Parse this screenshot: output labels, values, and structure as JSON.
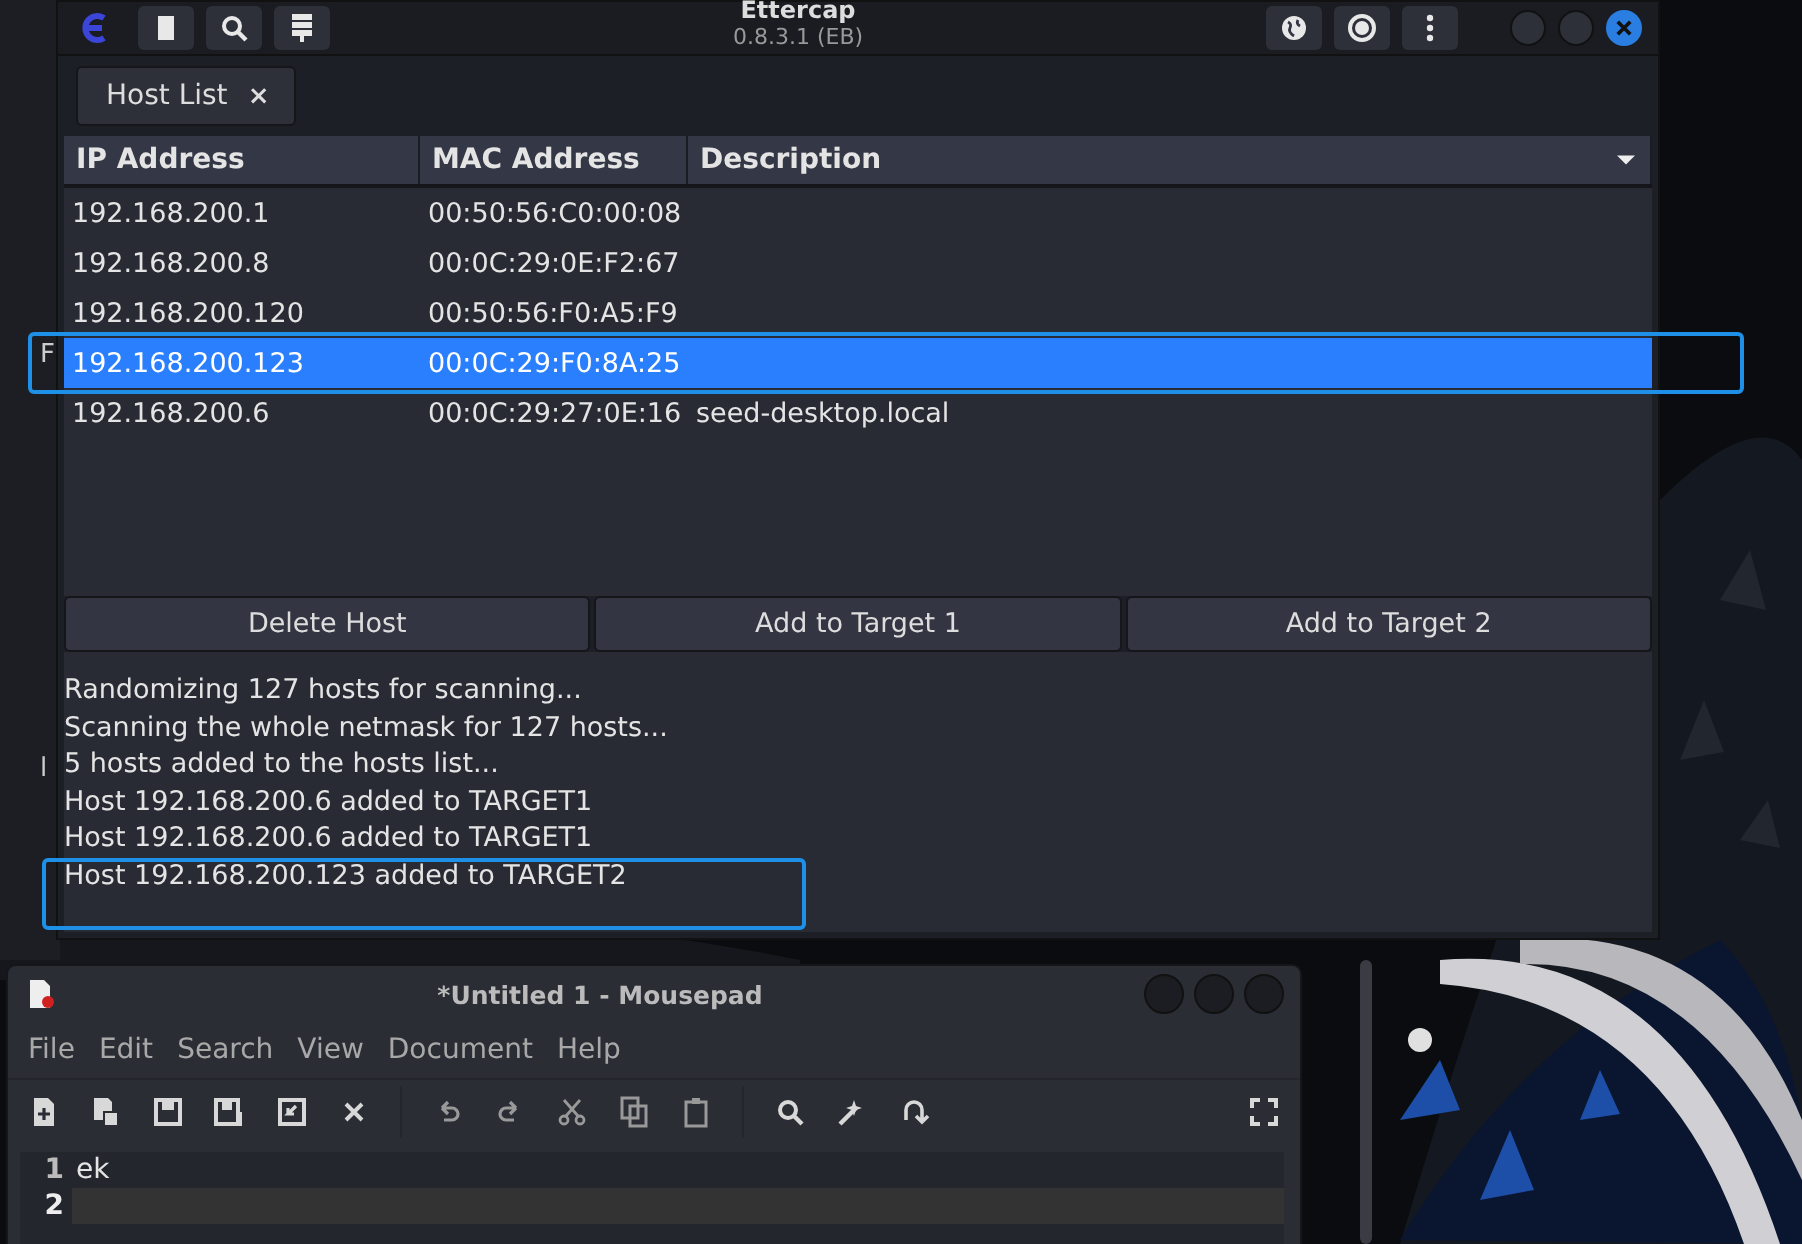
{
  "behind_window": {
    "fragments": [
      "F",
      "l"
    ]
  },
  "ettercap": {
    "title": "Ettercap",
    "version": "0.8.3.1 (EB)",
    "tabs": [
      {
        "label": "Host List",
        "close": "×",
        "selected": true
      }
    ],
    "host_table": {
      "columns": [
        "IP Address",
        "MAC Address",
        "Description"
      ],
      "rows": [
        {
          "ip": "192.168.200.1",
          "mac": "00:50:56:C0:00:08",
          "selected": false,
          "highlighted": false
        },
        {
          "ip": "192.168.200.8",
          "mac": "00:0C:29:0E:F2:67",
          "selected": false,
          "highlighted": false
        },
        {
          "ip": "192.168.200.120",
          "mac": "00:50:56:F0:A5:F9",
          "selected": false,
          "highlighted": false
        },
        {
          "ip": "192.168.200.123",
          "mac": "00:0C:29:F0:8A:25",
          "selected": true,
          "highlighted": true
        },
        {
          "ip": "192.168.200.6",
          "mac": "00:0C:29:27:0E:16",
          "description": "seed-desktop.local",
          "selected": false,
          "highlighted": false
        }
      ]
    },
    "buttons": [
      "Delete Host",
      "Add to Target 1",
      "Add to Target 2"
    ],
    "log": [
      {
        "text": "Randomizing 127 hosts for scanning...",
        "highlighted": false
      },
      {
        "text": "Scanning the whole netmask for 127 hosts...",
        "highlighted": false
      },
      {
        "text": "5 hosts added to the hosts list...",
        "highlighted": false
      },
      {
        "text": "Host 192.168.200.6 added to TARGET1",
        "highlighted": false
      },
      {
        "text": "Host 192.168.200.6 added to TARGET1",
        "highlighted": false
      },
      {
        "text": "Host 192.168.200.123 added to TARGET2",
        "highlighted": true
      }
    ]
  },
  "mousepad": {
    "title": "*Untitled 1 - Mousepad",
    "menu": [
      "File",
      "Edit",
      "Search",
      "View",
      "Document",
      "Help"
    ],
    "editor": {
      "lines": [
        {
          "number": "1",
          "text": "ek",
          "current": false
        },
        {
          "number": "2",
          "current": true
        }
      ]
    }
  }
}
